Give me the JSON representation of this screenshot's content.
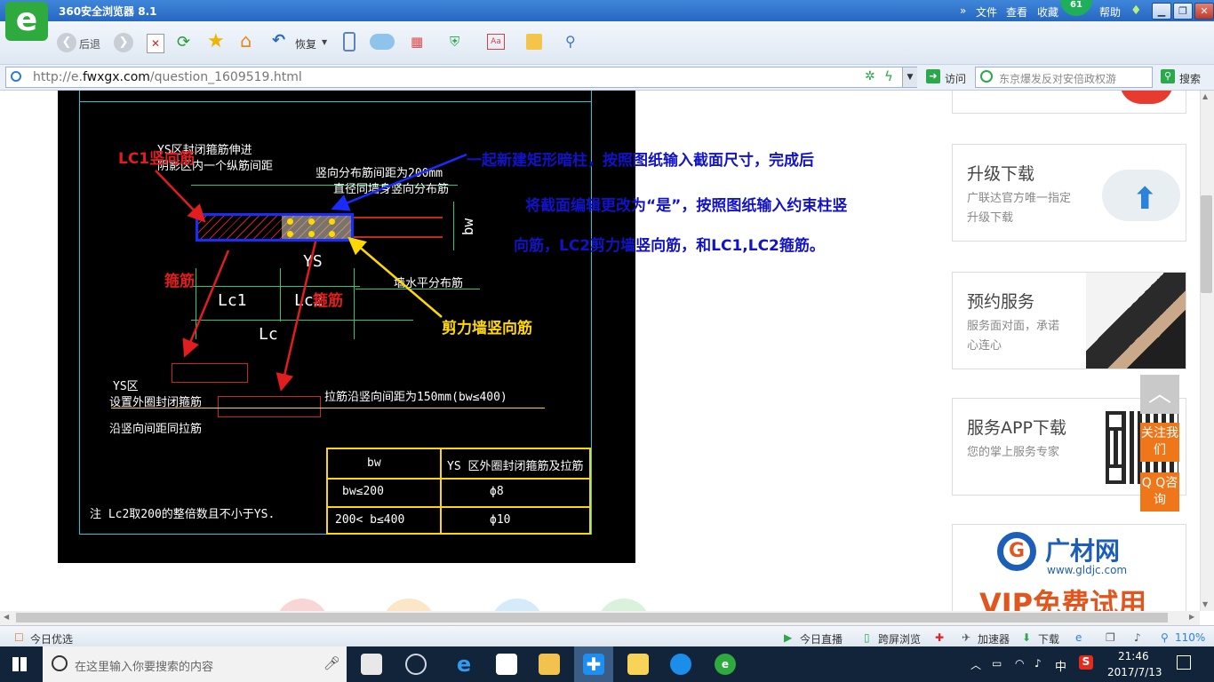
{
  "window": {
    "title": "360安全浏览器 8.1",
    "menu": [
      "文件",
      "查看",
      "收藏",
      "工具",
      "帮助"
    ],
    "badge": "61",
    "buttons": {
      "minimize": "▁",
      "restore": "❐",
      "close": "✕"
    }
  },
  "toolbar": {
    "back_label": "后退",
    "restore_label": "恢复"
  },
  "address": {
    "url_prefix": "http://e.",
    "url_domain": "fwxgx.com",
    "url_path": "/question_1609519.html",
    "go_label": "访问",
    "search_placeholder": "东京爆发反对安倍政权游",
    "search_label": "搜索"
  },
  "drawing": {
    "labels": {
      "top_left_1": "YS区封闭箍筋伸进",
      "top_left_2": "阴影区内一个纵筋间距",
      "top_mid_1": "竖向分布筋间距为200mm",
      "top_mid_2": "直径同墙身竖向分布筋",
      "bw": "bw",
      "ys": "YS",
      "lc1": "Lc1",
      "lc2": "Lc2",
      "lc": "Lc",
      "wall_h": "墙水平分布筋",
      "ys_zone_1": "YS区",
      "ys_zone_2": "设置外圈封闭箍筋",
      "ys_zone_3": "沿竖向间距同拉筋",
      "tie": "拉筋沿竖向间距为150mm(bw≤400)",
      "note": "注  Lc2取200的整倍数且不小于YS."
    },
    "table": {
      "headers": [
        "bw",
        "YS 区外圈封闭箍筋及拉筋"
      ],
      "rows": [
        [
          "bw≤200",
          "ϕ8"
        ],
        [
          "200< b≤400",
          "ϕ10"
        ]
      ]
    },
    "annotations": {
      "lc1_vertical": "LC1竖向筋",
      "stirrup_1": "箍筋",
      "stirrup_2": "箍筋",
      "shear_wall": "剪力墙竖向筋"
    }
  },
  "instruction": {
    "line1": "一起新建矩形暗柱，按照图纸输入截面尺寸，完成后",
    "line2": "将截面编辑更改为“是”，按照图纸输入约束柱竖",
    "line3": "向筋，LC2剪力墙竖向筋，和LC1,LC2箍筋。"
  },
  "sidebar": {
    "upgrade": {
      "title": "升级下载",
      "desc": "广联达官方唯一指定升级下载"
    },
    "appointment": {
      "title": "预约服务",
      "desc": "服务面对面，承诺心连心"
    },
    "app": {
      "title": "服务APP下载",
      "desc": "您的掌上服务专家"
    },
    "follow": "关注我们",
    "qq": "Q Q咨询",
    "ad": {
      "brand": "广材网",
      "url": "www.gldjc.com",
      "slogan": "VIP免费试用"
    }
  },
  "statusbar": {
    "left": "今日优选",
    "live": "今日直播",
    "cross": "跨屏浏览",
    "accelerator": "加速器",
    "download": "下载",
    "zoom": "110%"
  },
  "taskbar": {
    "search_placeholder": "在这里输入你要搜索的内容",
    "ime": "中",
    "time": "21:46",
    "date": "2017/7/13"
  },
  "colors": {
    "title_bar": "#2d6fca",
    "annotation_red": "#e11d1d",
    "annotation_blue": "#1212c8",
    "annotation_yellow": "#ffd800",
    "orange_button": "#f0761a"
  }
}
